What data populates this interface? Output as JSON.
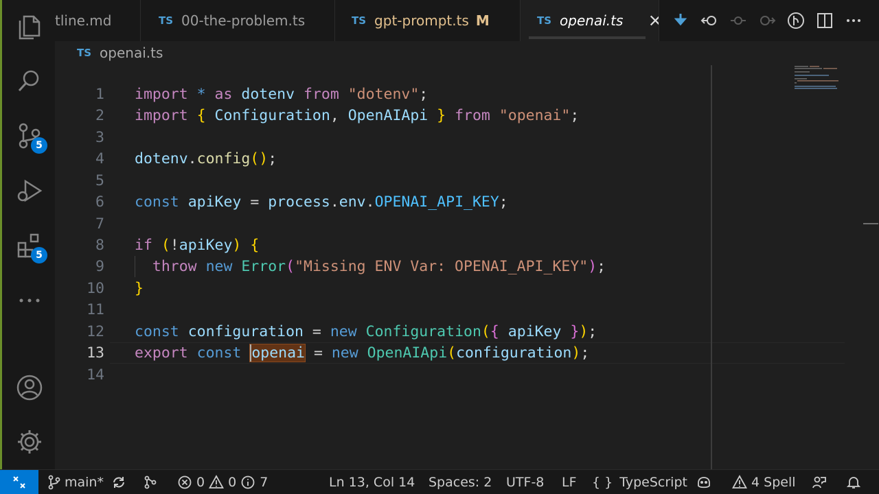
{
  "activity_bar": {
    "source_control_badge": "5",
    "extensions_badge": "5"
  },
  "tabs": [
    {
      "label": "tline.md",
      "type_badge": "",
      "modified": ""
    },
    {
      "label": "00-the-problem.ts",
      "type_badge": "TS",
      "modified": ""
    },
    {
      "label": "gpt-prompt.ts",
      "type_badge": "TS",
      "modified": "M"
    },
    {
      "label": "openai.ts",
      "type_badge": "TS",
      "modified": ""
    }
  ],
  "breadcrumb": {
    "type_badge": "TS",
    "file": "openai.ts"
  },
  "editor": {
    "line_numbers": [
      "1",
      "2",
      "3",
      "4",
      "5",
      "6",
      "7",
      "8",
      "9",
      "10",
      "11",
      "12",
      "13",
      "14"
    ]
  },
  "status_bar": {
    "branch": "main*",
    "errors": "0",
    "warnings": "0",
    "infos": "7",
    "cursor_position": "Ln 13, Col 14",
    "spaces": "Spaces: 2",
    "encoding": "UTF-8",
    "eol": "LF",
    "language_braces": "{ }",
    "language": "TypeScript",
    "spell": "4 Spell"
  },
  "colors": {
    "accent": "#0078d4",
    "modified": "#e2c08d",
    "ts_badge": "#4d9fd6"
  },
  "icons": [
    "files-icon",
    "search-icon",
    "source-control-icon",
    "run-debug-icon",
    "extensions-icon",
    "more-icon",
    "account-icon",
    "settings-gear-icon"
  ]
}
